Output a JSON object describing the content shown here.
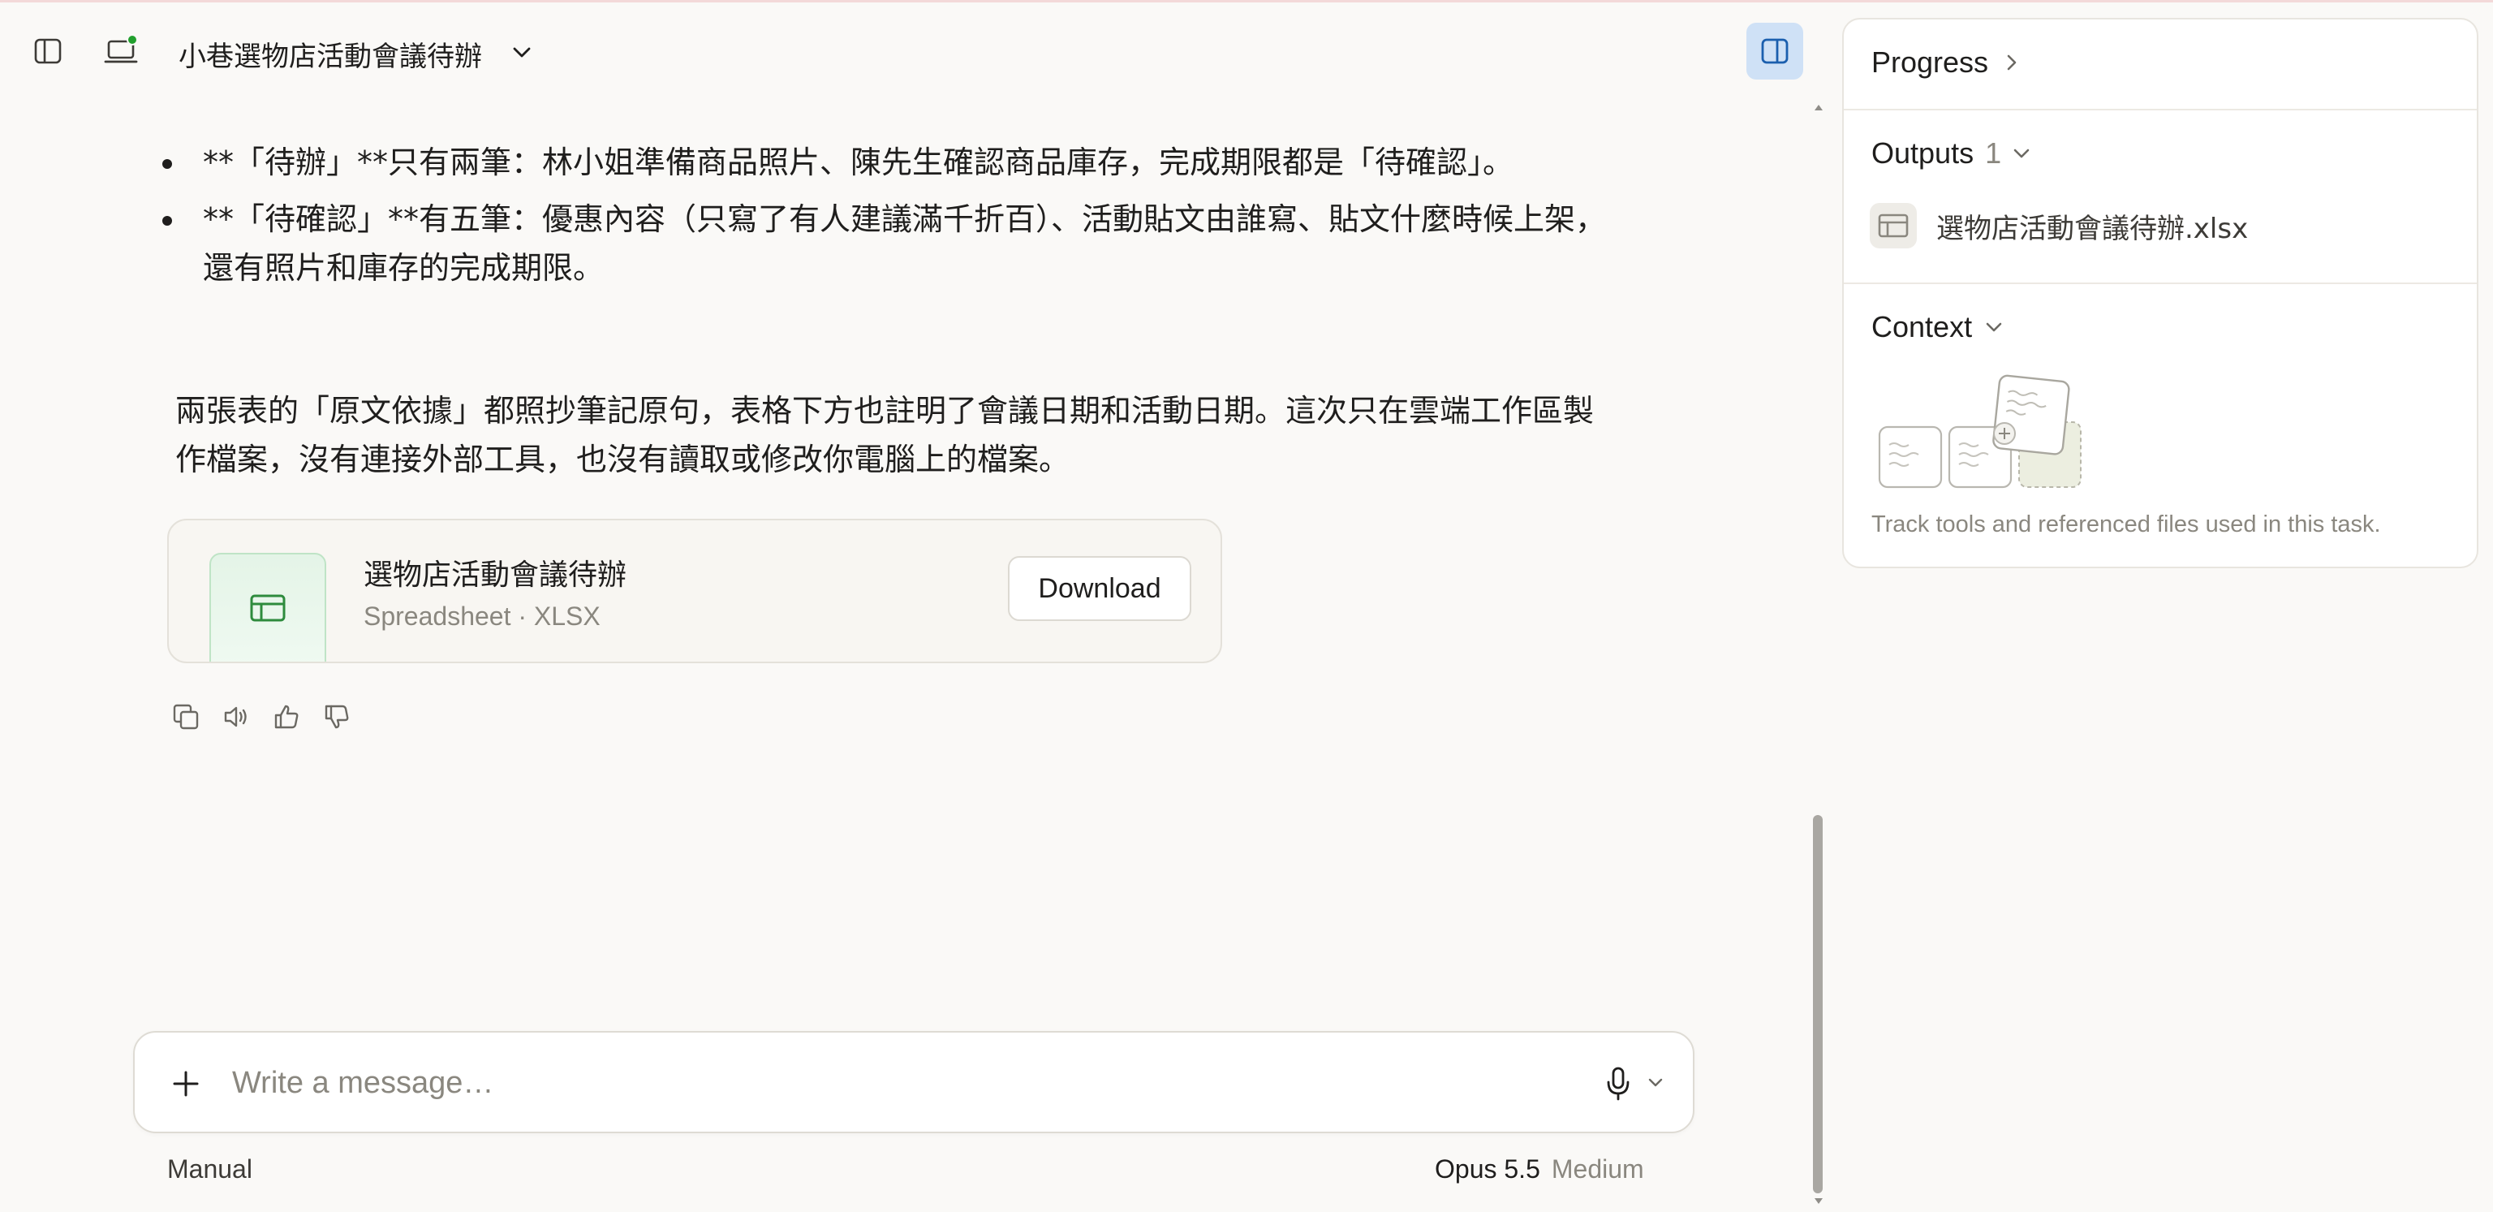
{
  "header": {
    "title": "小巷選物店活動會議待辦"
  },
  "message": {
    "bullets": [
      "**「待辦」**只有兩筆：林小姐準備商品照片、陳先生確認商品庫存，完成期限都是「待確認」。",
      "**「待確認」**有五筆：優惠內容（只寫了有人建議滿千折百）、活動貼文由誰寫、貼文什麼時候上架，還有照片和庫存的完成期限。"
    ],
    "paragraph": "兩張表的「原文依據」都照抄筆記原句，表格下方也註明了會議日期和活動日期。這次只在雲端工作區製作檔案，沒有連接外部工具，也沒有讀取或修改你電腦上的檔案。"
  },
  "file_card": {
    "name": "選物店活動會議待辦",
    "meta": "Spreadsheet · XLSX",
    "download_label": "Download"
  },
  "composer": {
    "placeholder": "Write a message…",
    "mode": "Manual",
    "model": "Opus 5.5",
    "effort": "Medium"
  },
  "panel": {
    "progress_title": "Progress",
    "outputs_title": "Outputs",
    "outputs_count": "1",
    "outputs": [
      {
        "name": "選物店活動會議待辦.xlsx"
      }
    ],
    "context_title": "Context",
    "context_desc": "Track tools and referenced files used in this task."
  },
  "colors": {
    "accent_toggle": "#cfe1f6",
    "status_dot": "#22a02e",
    "spreadsheet_green": "#2e8b3d"
  }
}
